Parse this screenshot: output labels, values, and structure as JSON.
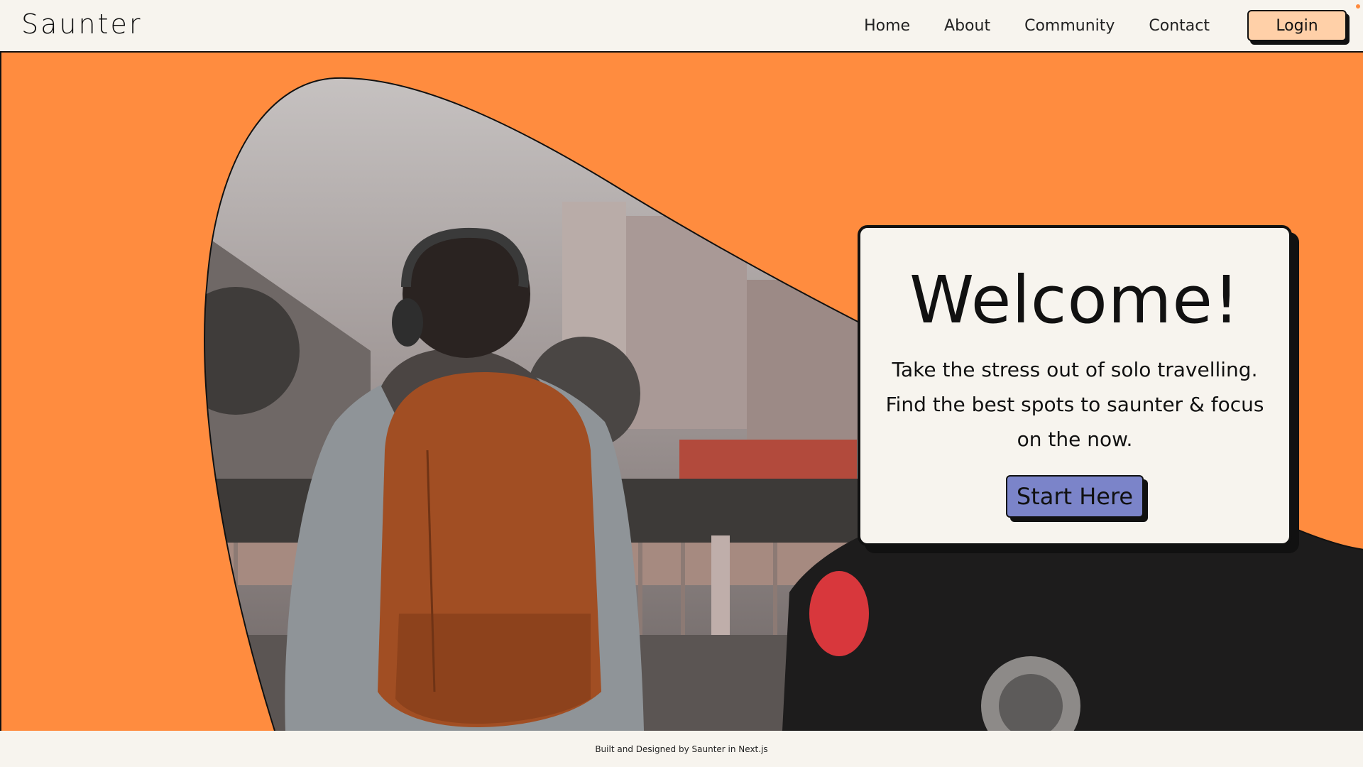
{
  "header": {
    "logo": "Saunter",
    "nav": [
      "Home",
      "About",
      "Community",
      "Contact"
    ],
    "login_label": "Login"
  },
  "hero": {
    "title": "Welcome!",
    "text": "Take the stress out of solo travelling. Find the best spots to saunter & focus on the now.",
    "cta_label": "Start Here",
    "image_icon": "traveller-with-backpack-photo"
  },
  "footer": {
    "credit": "Built and Designed by Saunter in Next.js"
  },
  "colors": {
    "accent_orange": "#ff8c3f",
    "background": "#f7f4ee",
    "login_button": "#ffd0a8",
    "cta_button": "#7b84c9"
  }
}
